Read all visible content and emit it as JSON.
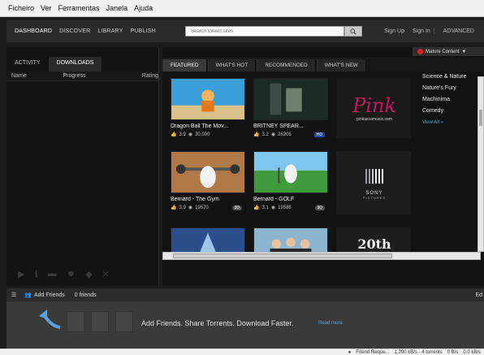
{
  "menubar": {
    "items": [
      "Ficheiro",
      "Ver",
      "Ferramentas",
      "Janela",
      "Ajuda"
    ]
  },
  "navbar": {
    "links": [
      "DASHBOARD",
      "DISCOVER",
      "LIBRARY",
      "PUBLISH"
    ],
    "search_placeholder": "Search torrent sites",
    "sign_up": "Sign Up",
    "sign_in": "Sign In",
    "separator": "|",
    "advanced": "ADVANCED"
  },
  "left_panel": {
    "tabs": [
      "ACTIVITY",
      "DOWNLOADS"
    ],
    "columns": {
      "name": "Name",
      "progress": "Progress",
      "rating": "Rating"
    }
  },
  "content": {
    "promo": "Mature Content",
    "tabs": [
      "FEATURED",
      "WHAT'S HOT",
      "RECOMMENDED",
      "WHAT'S NEW"
    ],
    "videos": [
      {
        "title": "Dragon Ball The Mov...",
        "likes": "3.9",
        "views": "30,000",
        "badge": ""
      },
      {
        "title": "BRITNEY SPEAR...",
        "likes": "3.2",
        "views": "26205",
        "badge": "HD"
      },
      {
        "title": "Bernard - The Gym",
        "likes": "3.9",
        "views": "19570",
        "badge": "3D"
      },
      {
        "title": "Bernard - GOLF",
        "likes": "3.1",
        "views": "19588",
        "badge": "3D"
      }
    ],
    "logos": {
      "pink": "Pink",
      "pink_sub": "pinkusoamusic.com",
      "sony": "SONY",
      "sony_sub": "PICTURES",
      "fox": "20th"
    },
    "categories": [
      "Science & Nature",
      "Nature's Fury",
      "Machinima",
      "Comedy"
    ],
    "view_all": "View All »"
  },
  "friends": {
    "add_label": "Add Friends",
    "count": "0 friends",
    "message": "Add Friends.  Share Torrents.  Download Faster.",
    "read_more": "Read more",
    "edit": "Ed"
  },
  "status": {
    "friend_req": "Friend Reque...",
    "dl_speed": "1,290 kB/s - 4 torrents",
    "down": "0 B/s",
    "up": "0.0 kB/s"
  }
}
